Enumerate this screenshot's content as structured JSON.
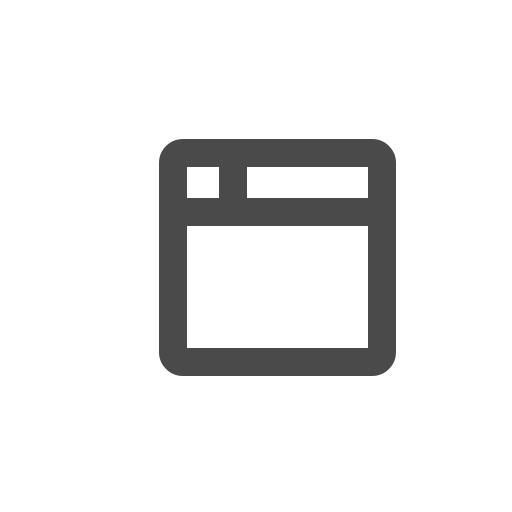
{
  "icon": {
    "name": "browser-window-icon",
    "color": "#4a4a4a",
    "background": "#ffffff"
  }
}
